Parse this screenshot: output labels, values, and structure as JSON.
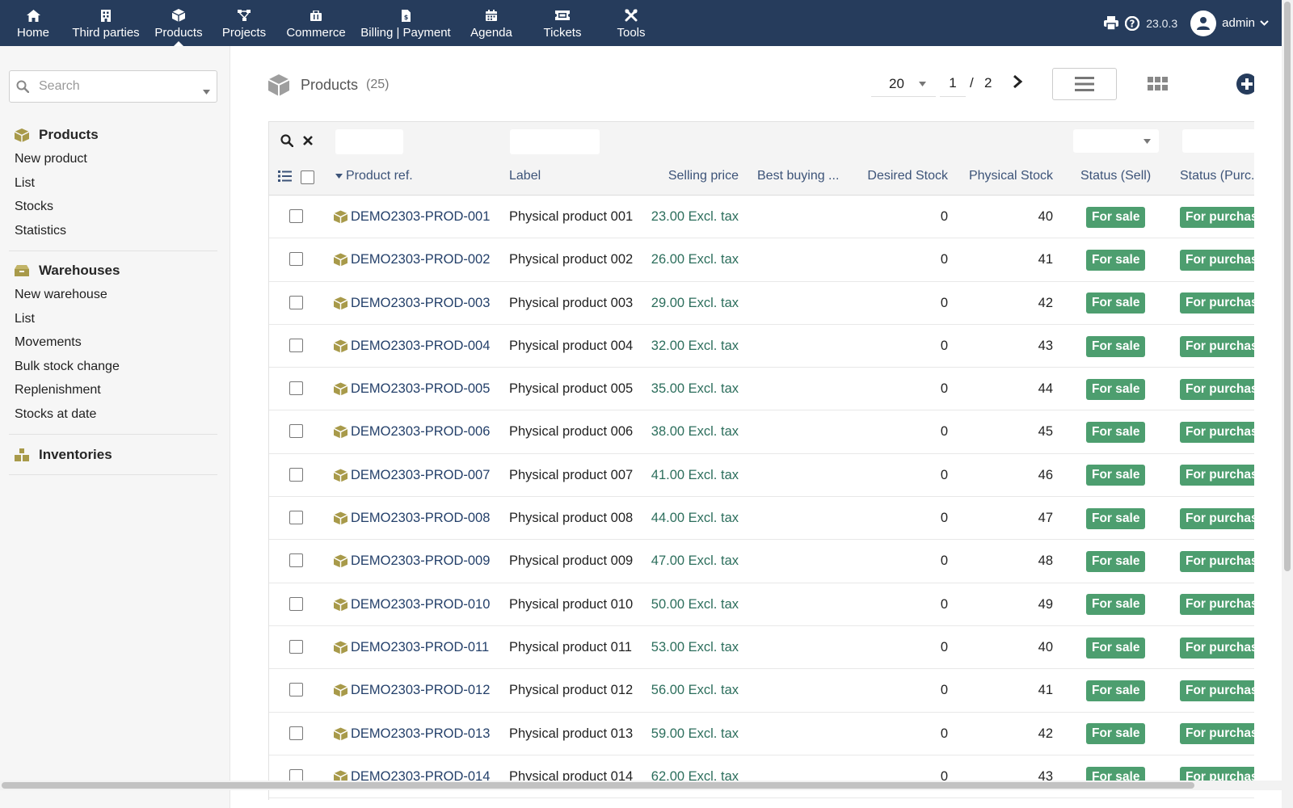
{
  "nav": {
    "items": [
      {
        "label": "Home",
        "icon": "home-icon"
      },
      {
        "label": "Third parties",
        "icon": "building-icon"
      },
      {
        "label": "Products",
        "icon": "cube-icon",
        "active": true
      },
      {
        "label": "Projects",
        "icon": "project-icon"
      },
      {
        "label": "Commerce",
        "icon": "briefcase-icon"
      },
      {
        "label": "Billing | Payment",
        "icon": "invoice-icon"
      },
      {
        "label": "Agenda",
        "icon": "calendar-icon"
      },
      {
        "label": "Tickets",
        "icon": "ticket-icon"
      },
      {
        "label": "Tools",
        "icon": "tools-icon"
      }
    ],
    "version": "23.0.3",
    "user": "admin"
  },
  "sidebar": {
    "search_placeholder": "Search",
    "products": {
      "title": "Products",
      "items": [
        "New product",
        "List",
        "Stocks",
        "Statistics"
      ]
    },
    "warehouses": {
      "title": "Warehouses",
      "items": [
        "New warehouse",
        "List",
        "Movements",
        "Bulk stock change",
        "Replenishment",
        "Stocks at date"
      ]
    },
    "inventories": {
      "title": "Inventories"
    }
  },
  "page": {
    "title": "Products",
    "count": "(25)",
    "limit": "20",
    "current_page": "1",
    "page_separator": "/",
    "total_pages": "2"
  },
  "table": {
    "columns": {
      "ref": "Product ref.",
      "label": "Label",
      "selling_price": "Selling price",
      "best_buying": "Best buying ...",
      "desired_stock": "Desired Stock",
      "physical_stock": "Physical Stock",
      "status_sell": "Status (Sell)",
      "status_purchase": "Status (Purc..."
    },
    "rows": [
      {
        "ref": "DEMO2303-PROD-001",
        "label": "Physical product 001",
        "price": "23.00 Excl. tax",
        "desired": "0",
        "physical": "40",
        "status_sell": "For sale",
        "status_purchase": "For purchase"
      },
      {
        "ref": "DEMO2303-PROD-002",
        "label": "Physical product 002",
        "price": "26.00 Excl. tax",
        "desired": "0",
        "physical": "41",
        "status_sell": "For sale",
        "status_purchase": "For purchase"
      },
      {
        "ref": "DEMO2303-PROD-003",
        "label": "Physical product 003",
        "price": "29.00 Excl. tax",
        "desired": "0",
        "physical": "42",
        "status_sell": "For sale",
        "status_purchase": "For purchase"
      },
      {
        "ref": "DEMO2303-PROD-004",
        "label": "Physical product 004",
        "price": "32.00 Excl. tax",
        "desired": "0",
        "physical": "43",
        "status_sell": "For sale",
        "status_purchase": "For purchase"
      },
      {
        "ref": "DEMO2303-PROD-005",
        "label": "Physical product 005",
        "price": "35.00 Excl. tax",
        "desired": "0",
        "physical": "44",
        "status_sell": "For sale",
        "status_purchase": "For purchase"
      },
      {
        "ref": "DEMO2303-PROD-006",
        "label": "Physical product 006",
        "price": "38.00 Excl. tax",
        "desired": "0",
        "physical": "45",
        "status_sell": "For sale",
        "status_purchase": "For purchase"
      },
      {
        "ref": "DEMO2303-PROD-007",
        "label": "Physical product 007",
        "price": "41.00 Excl. tax",
        "desired": "0",
        "physical": "46",
        "status_sell": "For sale",
        "status_purchase": "For purchase"
      },
      {
        "ref": "DEMO2303-PROD-008",
        "label": "Physical product 008",
        "price": "44.00 Excl. tax",
        "desired": "0",
        "physical": "47",
        "status_sell": "For sale",
        "status_purchase": "For purchase"
      },
      {
        "ref": "DEMO2303-PROD-009",
        "label": "Physical product 009",
        "price": "47.00 Excl. tax",
        "desired": "0",
        "physical": "48",
        "status_sell": "For sale",
        "status_purchase": "For purchase"
      },
      {
        "ref": "DEMO2303-PROD-010",
        "label": "Physical product 010",
        "price": "50.00 Excl. tax",
        "desired": "0",
        "physical": "49",
        "status_sell": "For sale",
        "status_purchase": "For purchase"
      },
      {
        "ref": "DEMO2303-PROD-011",
        "label": "Physical product 011",
        "price": "53.00 Excl. tax",
        "desired": "0",
        "physical": "40",
        "status_sell": "For sale",
        "status_purchase": "For purchase"
      },
      {
        "ref": "DEMO2303-PROD-012",
        "label": "Physical product 012",
        "price": "56.00 Excl. tax",
        "desired": "0",
        "physical": "41",
        "status_sell": "For sale",
        "status_purchase": "For purchase"
      },
      {
        "ref": "DEMO2303-PROD-013",
        "label": "Physical product 013",
        "price": "59.00 Excl. tax",
        "desired": "0",
        "physical": "42",
        "status_sell": "For sale",
        "status_purchase": "For purchase"
      },
      {
        "ref": "DEMO2303-PROD-014",
        "label": "Physical product 014",
        "price": "62.00 Excl. tax",
        "desired": "0",
        "physical": "43",
        "status_sell": "For sale",
        "status_purchase": "For purchase"
      }
    ]
  },
  "colors": {
    "topbar": "#263c5c",
    "badge": "#4d9e6f",
    "link": "#24406a",
    "price": "#2c6e5c",
    "module_icon": "#a89a4a"
  }
}
